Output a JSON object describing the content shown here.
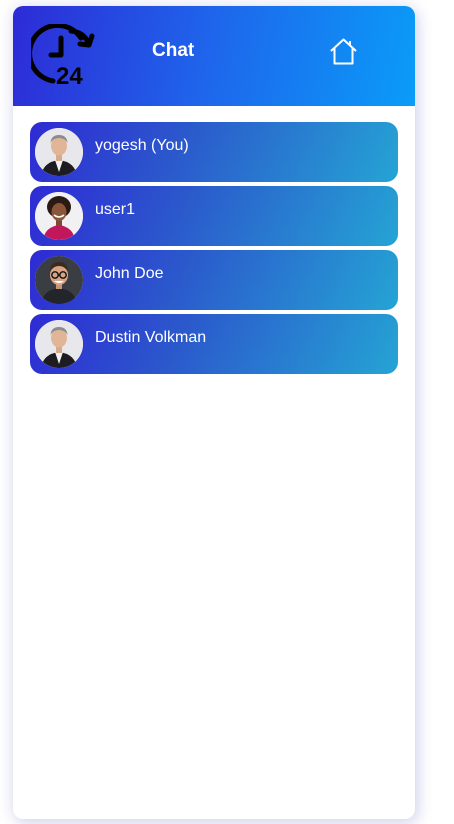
{
  "app": {
    "title": "Chat",
    "logo_icon": "24-hours-clock-icon",
    "home_icon": "home-icon"
  },
  "contacts": [
    {
      "name": "yogesh (You)",
      "avatar": "man-in-suit-avatar"
    },
    {
      "name": "user1",
      "avatar": "woman-curly-hair-avatar"
    },
    {
      "name": "John Doe",
      "avatar": "man-glasses-avatar"
    },
    {
      "name": "Dustin Volkman",
      "avatar": "man-in-suit-avatar"
    }
  ],
  "colors": {
    "header_start": "#2d2bd6",
    "header_end": "#0a9cf8",
    "item_start": "#2f2ad4",
    "item_end": "#25a4d4",
    "text": "#ffffff"
  }
}
